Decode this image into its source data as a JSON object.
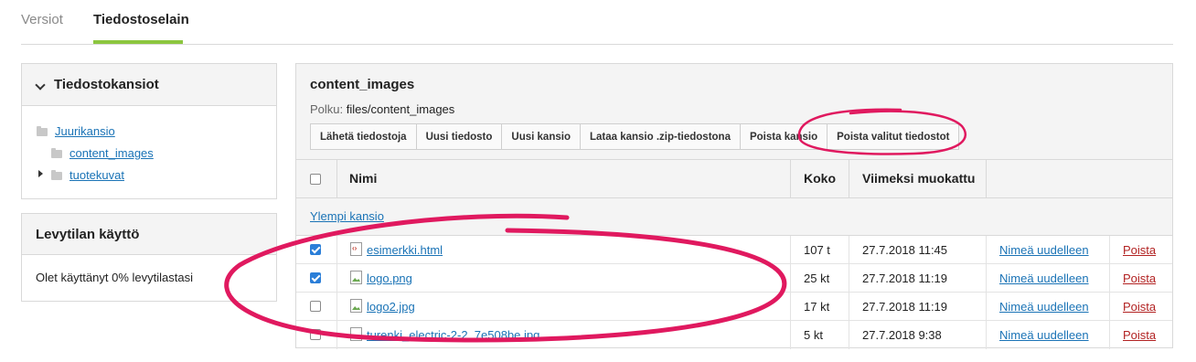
{
  "tabs": [
    {
      "label": "Versiot",
      "active": false
    },
    {
      "label": "Tiedostoselain",
      "active": true
    }
  ],
  "folders_panel": {
    "title": "Tiedostokansiot",
    "items": [
      {
        "label": "Juurikansio"
      },
      {
        "label": "content_images"
      },
      {
        "label": "tuotekuvat"
      }
    ]
  },
  "usage_panel": {
    "title": "Levytilan käyttö",
    "text": "Olet käyttänyt 0% levytilastasi"
  },
  "main": {
    "folder_name": "content_images",
    "path_label": "Polku:",
    "path_value": "files/content_images",
    "buttons": [
      "Lähetä tiedostoja",
      "Uusi tiedosto",
      "Uusi kansio",
      "Lataa kansio .zip-tiedostona",
      "Poista kansio",
      "Poista valitut tiedostot"
    ]
  },
  "table": {
    "headers": {
      "name": "Nimi",
      "size": "Koko",
      "modified": "Viimeksi muokattu"
    },
    "parent_link": "Ylempi kansio",
    "rows": [
      {
        "checked": true,
        "icon": "html-file-icon",
        "name": "esimerkki.html",
        "size": "107 t",
        "modified": "27.7.2018 11:45",
        "rename": "Nimeä uudelleen",
        "delete": "Poista"
      },
      {
        "checked": true,
        "icon": "image-file-icon",
        "name": "logo.png",
        "size": "25 kt",
        "modified": "27.7.2018 11:19",
        "rename": "Nimeä uudelleen",
        "delete": "Poista"
      },
      {
        "checked": false,
        "icon": "image-file-icon",
        "name": "logo2.jpg",
        "size": "17 kt",
        "modified": "27.7.2018 11:19",
        "rename": "Nimeä uudelleen",
        "delete": "Poista"
      },
      {
        "checked": false,
        "icon": "image-file-icon",
        "name": "turenki_electric-2-2_7e508be.jpg",
        "size": "5 kt",
        "modified": "27.7.2018 9:38",
        "rename": "Nimeä uudelleen",
        "delete": "Poista"
      }
    ]
  },
  "colors": {
    "accent_tab": "#8cc63f",
    "link": "#1a73b6",
    "delete": "#b22222",
    "annotation": "#e0195f"
  }
}
